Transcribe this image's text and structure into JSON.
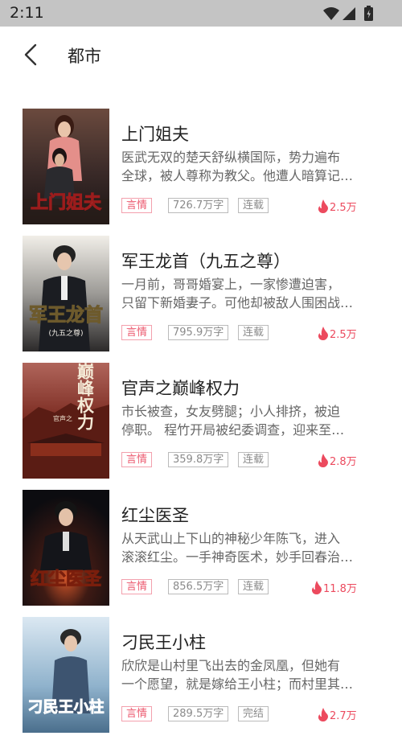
{
  "status_bar": {
    "time": "2:11"
  },
  "header": {
    "title": "都市"
  },
  "books": [
    {
      "title": "上门姐夫",
      "desc_line1": "医武无双的楚天舒纵横国际，势力遍布",
      "desc_line2": "全球，被人尊称为教父。他遭人暗算记…",
      "genre": "言情",
      "words": "726.7万字",
      "status": "连载",
      "heat": "2.5万",
      "cover_text": "上门姐夫"
    },
    {
      "title": "军王龙首（九五之尊）",
      "desc_line1": "一月前，哥哥婚宴上，一家惨遭迫害，",
      "desc_line2": "只留下新婚妻子。可他却被敌人围困战…",
      "genre": "言情",
      "words": "795.9万字",
      "status": "连载",
      "heat": "2.5万",
      "cover_text": "军王龙首",
      "cover_subtext": "(九五之尊)"
    },
    {
      "title": "官声之巅峰权力",
      "desc_line1": "市长被查，女友劈腿；小人排挤，被迫",
      "desc_line2": "停职。 程竹开局被纪委调查，迎来至…",
      "genre": "言情",
      "words": "359.8万字",
      "status": "连载",
      "heat": "2.8万",
      "cover_text": "巅峰权力",
      "cover_subtext": "官声之"
    },
    {
      "title": "红尘医圣",
      "desc_line1": "从天武山上下山的神秘少年陈飞，进入",
      "desc_line2": "滚滚红尘。一手神奇医术，妙手回春治…",
      "genre": "言情",
      "words": "856.5万字",
      "status": "连载",
      "heat": "11.8万",
      "cover_text": "红尘医圣"
    },
    {
      "title": "刁民王小柱",
      "desc_line1": "欣欣是山村里飞出去的金凤凰，但她有",
      "desc_line2": "一个愿望，就是嫁给王小柱；而村里其…",
      "genre": "言情",
      "words": "289.5万字",
      "status": "完结",
      "heat": "2.7万",
      "cover_text": "刁民王小柱"
    }
  ]
}
